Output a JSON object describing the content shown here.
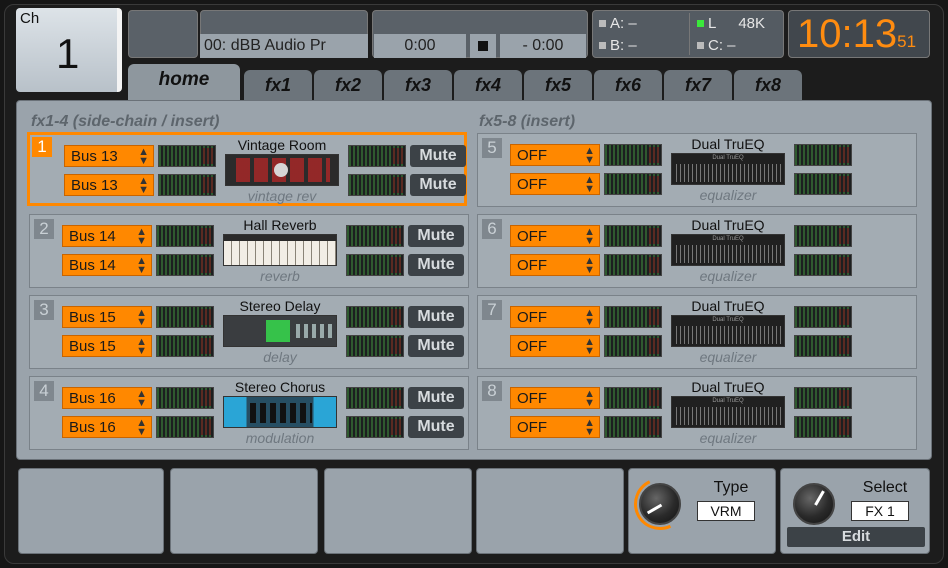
{
  "header": {
    "channel_label": "Ch",
    "channel_number": "1",
    "scene_name": "00: dBB Audio Pr",
    "time_elapsed": "0:00",
    "time_remaining": "- 0:00",
    "assign_a": "A:  –",
    "assign_b": "B:  –",
    "assign_c": "C:  –",
    "usb_l": "L",
    "sample_rate": "48K",
    "clock_hm": "10:13",
    "clock_sec": "51",
    "accent_color": "#ff8c10"
  },
  "tabs": [
    "home",
    "fx1",
    "fx2",
    "fx3",
    "fx4",
    "fx5",
    "fx6",
    "fx7",
    "fx8"
  ],
  "sections": {
    "left_title": "fx1-4 (side-chain / insert)",
    "right_title": "fx5-8 (insert)"
  },
  "slots": [
    {
      "num": "1",
      "src_l": "Bus 13",
      "src_r": "Bus 13",
      "name": "Vintage Room",
      "type": "vintage rev",
      "mute_l": "Mute",
      "mute_r": "Mute"
    },
    {
      "num": "2",
      "src_l": "Bus 14",
      "src_r": "Bus 14",
      "name": "Hall Reverb",
      "type": "reverb",
      "mute_l": "Mute",
      "mute_r": "Mute"
    },
    {
      "num": "3",
      "src_l": "Bus 15",
      "src_r": "Bus 15",
      "name": "Stereo Delay",
      "type": "delay",
      "mute_l": "Mute",
      "mute_r": "Mute"
    },
    {
      "num": "4",
      "src_l": "Bus 16",
      "src_r": "Bus 16",
      "name": "Stereo Chorus",
      "type": "modulation",
      "mute_l": "Mute",
      "mute_r": "Mute"
    },
    {
      "num": "5",
      "src_l": "OFF",
      "src_r": "OFF",
      "name": "Dual TruEQ",
      "type": "equalizer",
      "thumb_title": "Dual TruEQ"
    },
    {
      "num": "6",
      "src_l": "OFF",
      "src_r": "OFF",
      "name": "Dual TruEQ",
      "type": "equalizer",
      "thumb_title": "Dual TruEQ"
    },
    {
      "num": "7",
      "src_l": "OFF",
      "src_r": "OFF",
      "name": "Dual TruEQ",
      "type": "equalizer",
      "thumb_title": "Dual TruEQ"
    },
    {
      "num": "8",
      "src_l": "OFF",
      "src_r": "OFF",
      "name": "Dual TruEQ",
      "type": "equalizer",
      "thumb_title": "Dual TruEQ"
    }
  ],
  "bottom": {
    "type_label": "Type",
    "type_value": "VRM",
    "select_label": "Select",
    "select_value": "FX 1",
    "edit_label": "Edit"
  }
}
